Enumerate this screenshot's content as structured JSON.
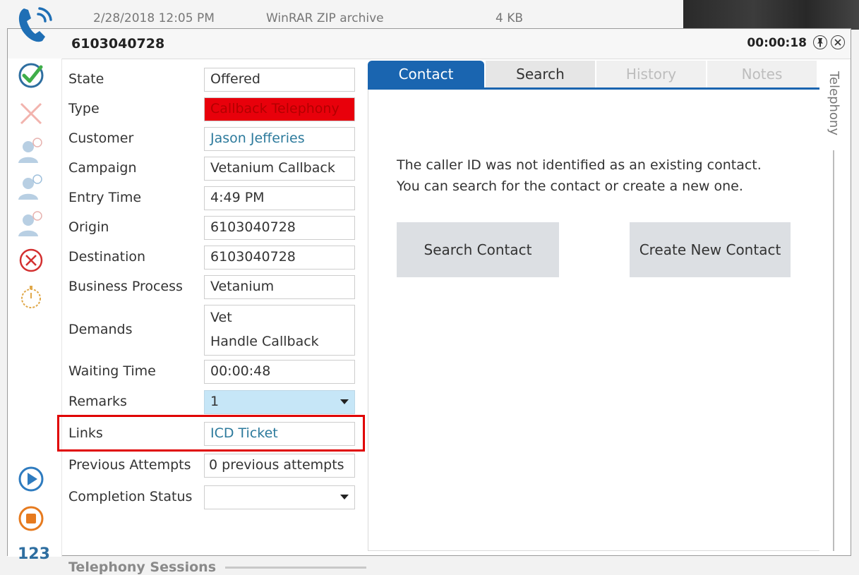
{
  "background_file": {
    "date": "2/28/2018 12:05 PM",
    "type": "WinRAR ZIP archive",
    "size": "4 KB"
  },
  "window": {
    "title": "6103040728",
    "timer": "00:00:18"
  },
  "toolbar": {
    "count_label": "123"
  },
  "fields": [
    {
      "label": "State",
      "value": "Offered"
    },
    {
      "label": "Type",
      "value": "Callback Telephony"
    },
    {
      "label": "Customer",
      "value": "Jason Jefferies"
    },
    {
      "label": "Campaign",
      "value": "Vetanium Callback"
    },
    {
      "label": "Entry Time",
      "value": "4:49 PM"
    },
    {
      "label": "Origin",
      "value": "6103040728"
    },
    {
      "label": "Destination",
      "value": "6103040728"
    },
    {
      "label": "Business Process",
      "value": "Vetanium"
    },
    {
      "label": "Demands",
      "value_line1": "Vet",
      "value_line2": "Handle Callback"
    },
    {
      "label": "Waiting Time",
      "value": "00:00:48"
    },
    {
      "label": "Remarks",
      "value": "1"
    },
    {
      "label": "Links",
      "value": "ICD Ticket"
    },
    {
      "label": "Previous Attempts",
      "value": "0 previous attempts"
    },
    {
      "label": "Completion Status",
      "value": ""
    }
  ],
  "sessions_label": "Telephony Sessions",
  "tabs": [
    "Contact",
    "Search",
    "History",
    "Notes"
  ],
  "contact": {
    "message_line1": "The caller ID was not identified as an existing contact.",
    "message_line2": "You can search for the contact or create a new one.",
    "search_button": "Search Contact",
    "create_button": "Create New Contact"
  },
  "side_tab": "Telephony",
  "colors": {
    "accent": "#1a65b0",
    "type_highlight": "#e8000b",
    "remarks_bg": "#c6e6f7",
    "highlight_border": "#e00000"
  }
}
